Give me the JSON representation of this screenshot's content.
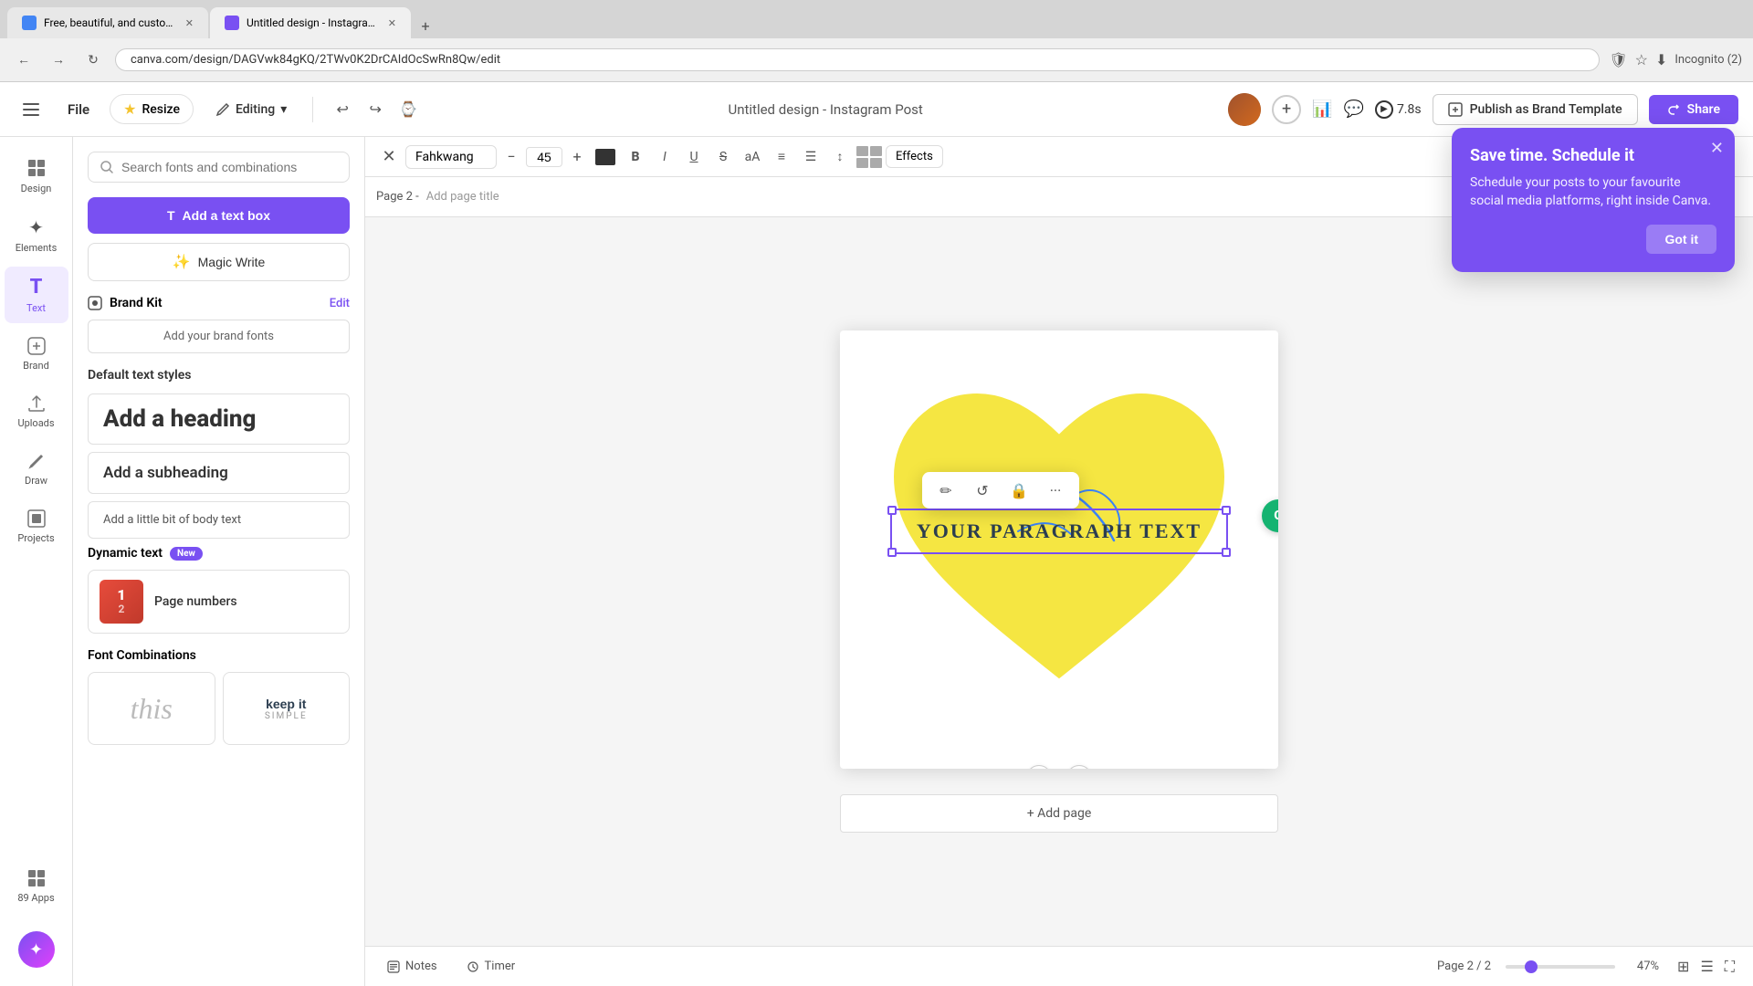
{
  "browser": {
    "tabs": [
      {
        "id": "tab1",
        "title": "Free, beautiful, and customizabl...",
        "favicon_color": "#4285f4",
        "active": false
      },
      {
        "id": "tab2",
        "title": "Untitled design - Instagram Po...",
        "favicon_color": "#7950f2",
        "active": true
      }
    ],
    "new_tab_label": "+",
    "address": "canva.com/design/DAGVwk84gKQ/2TWv0K2DrCAIdOcSwRn8Qw/edit",
    "back_btn": "←",
    "forward_btn": "→",
    "refresh_btn": "↻"
  },
  "toolbar": {
    "menu_icon": "☰",
    "file_label": "File",
    "resize_label": "Resize",
    "editing_label": "Editing",
    "editing_chevron": "▾",
    "undo_icon": "↩",
    "redo_icon": "↪",
    "history_icon": "⌚",
    "doc_title": "Untitled design - Instagram Post",
    "add_collaborator": "+",
    "present_label": "7.8s",
    "publish_label": "Publish as Brand Template",
    "share_label": "Share"
  },
  "sidebar_icons": [
    {
      "id": "design",
      "label": "Design",
      "icon": "⊞"
    },
    {
      "id": "elements",
      "label": "Elements",
      "icon": "✦"
    },
    {
      "id": "text",
      "label": "Text",
      "icon": "T",
      "active": true
    },
    {
      "id": "brand",
      "label": "Brand",
      "icon": "◈"
    },
    {
      "id": "uploads",
      "label": "Uploads",
      "icon": "↑"
    },
    {
      "id": "draw",
      "label": "Draw",
      "icon": "✏"
    },
    {
      "id": "projects",
      "label": "Projects",
      "icon": "⊡"
    },
    {
      "id": "apps",
      "label": "Apps",
      "icon": "⊞",
      "badge": "89"
    }
  ],
  "magic_btn_icon": "✦",
  "text_panel": {
    "search_placeholder": "Search fonts and combinations",
    "add_textbox_label": "Add a text box",
    "magic_write_label": "Magic Write",
    "brand_kit_label": "Brand Kit",
    "edit_label": "Edit",
    "add_brand_fonts_label": "Add your brand fonts",
    "default_styles_title": "Default text styles",
    "heading_label": "Add a heading",
    "subheading_label": "Add a subheading",
    "body_label": "Add a little bit of body text",
    "dynamic_text_label": "Dynamic text",
    "new_badge_label": "New",
    "page_numbers_label": "Page numbers",
    "font_combinations_label": "Font Combinations",
    "font_combo_1": "this",
    "font_combo_2_title": "keep it",
    "font_combo_2_sub": "SIMPLE"
  },
  "format_toolbar": {
    "font_name": "Fahkwang",
    "font_size": "45",
    "bold": "B",
    "italic": "I",
    "underline": "U",
    "strikethrough": "S",
    "case_btn": "aA",
    "align_btn": "≡",
    "list_btn": "☰",
    "spacing_btn": "↕",
    "effects_label": "Effects"
  },
  "canvas": {
    "page_label": "Page 2 -",
    "page_title_placeholder": "Add page title",
    "canvas_text": "YOUR PARAGRAPH TEXT",
    "add_page_label": "+ Add page"
  },
  "bottom_bar": {
    "notes_label": "Notes",
    "timer_label": "Timer",
    "page_info": "Page 2 / 2",
    "zoom_value": 47,
    "zoom_label": "47%"
  },
  "notification": {
    "title": "Save time. Schedule it",
    "description": "Schedule your posts to your favourite social media platforms, right inside Canva.",
    "got_it_label": "Got it"
  }
}
